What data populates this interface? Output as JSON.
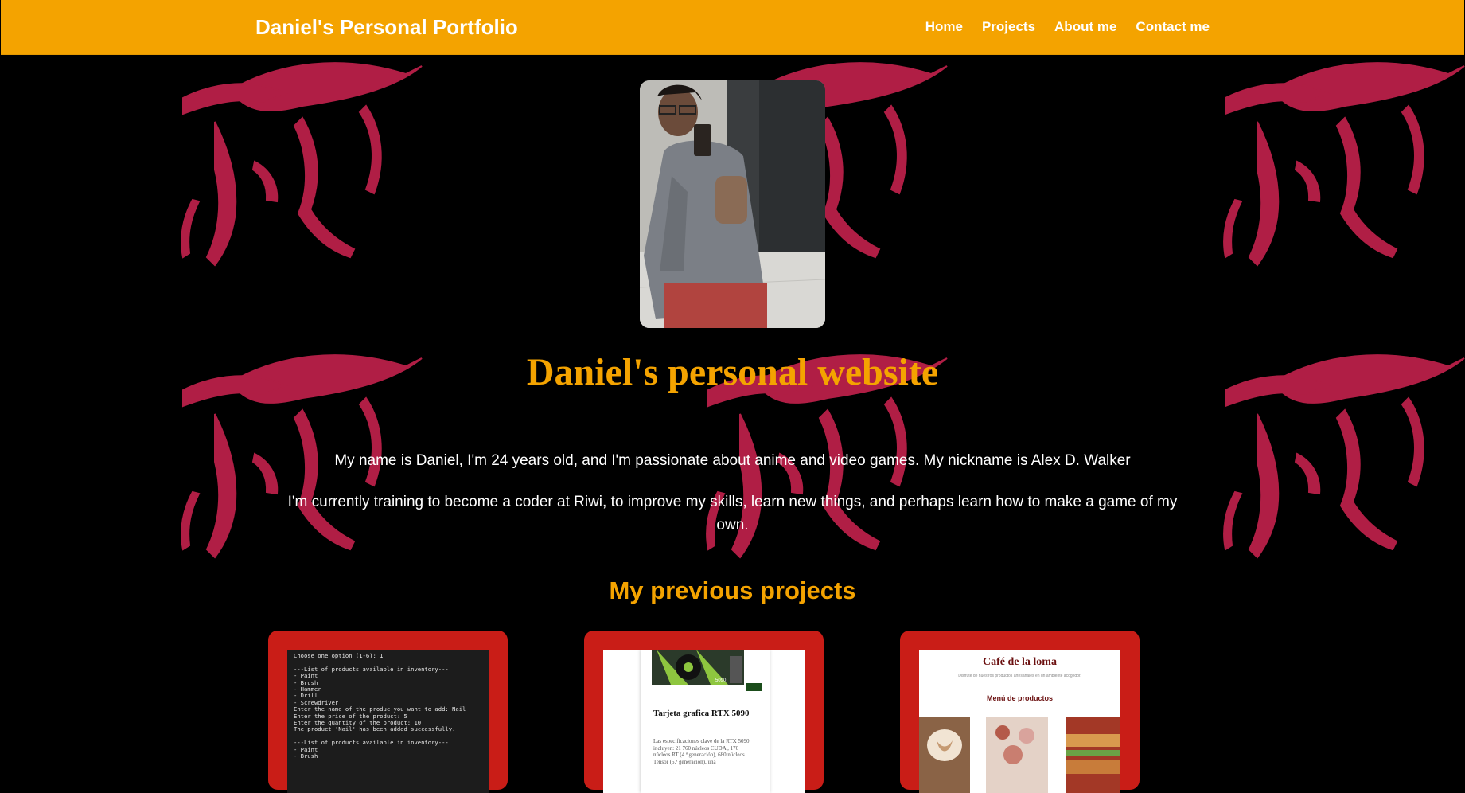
{
  "header": {
    "brand": "Daniel's Personal Portfolio",
    "nav": [
      "Home",
      "Projects",
      "About me",
      "Contact me"
    ]
  },
  "hero": {
    "title": "Daniel's personal website",
    "paragraphs": [
      "My name is Daniel, I'm 24 years old, and I'm passionate about anime and video games. My nickname is Alex D. Walker",
      "I'm currently training to become a coder at Riwi, to improve my skills, learn new things, and perhaps learn how to make a game of my own."
    ]
  },
  "projects": {
    "heading": "My previous projects",
    "terminal_lines": [
      "Choose one option (1-6): 1",
      "",
      "---List of products available in inventory---",
      "- Paint",
      "- Brush",
      "- Hammer",
      "- Drill",
      "- Screwdriver",
      "Enter the name of the produc you want to add: Nail",
      "Enter the price of the product: 5",
      "Enter the quantity of the product: 10",
      "The product 'Nail' has been added successfully.",
      "",
      "---List of products available in inventory---",
      "- Paint",
      "- Brush"
    ],
    "gpu": {
      "title": "Tarjeta grafica RTX 5090",
      "box_label": "5090",
      "text": "Las especificaciones clave de la RTX 5090 incluyen: 21 760 núcleos CUDA , 170 núcleos RT (4.ª generación), 680 núcleos Tensor (5.ª generación), una"
    },
    "cafe": {
      "title": "Café de la loma",
      "subtitle": "Disfrute de nuestros productos artesanales en un ambiente acogedor.",
      "menu": "Menú de productos"
    }
  },
  "colors": {
    "header": "#f4a300",
    "accent": "#f4a300",
    "card": "#c91d17",
    "pattern": "#b01e45",
    "background": "#000000"
  }
}
